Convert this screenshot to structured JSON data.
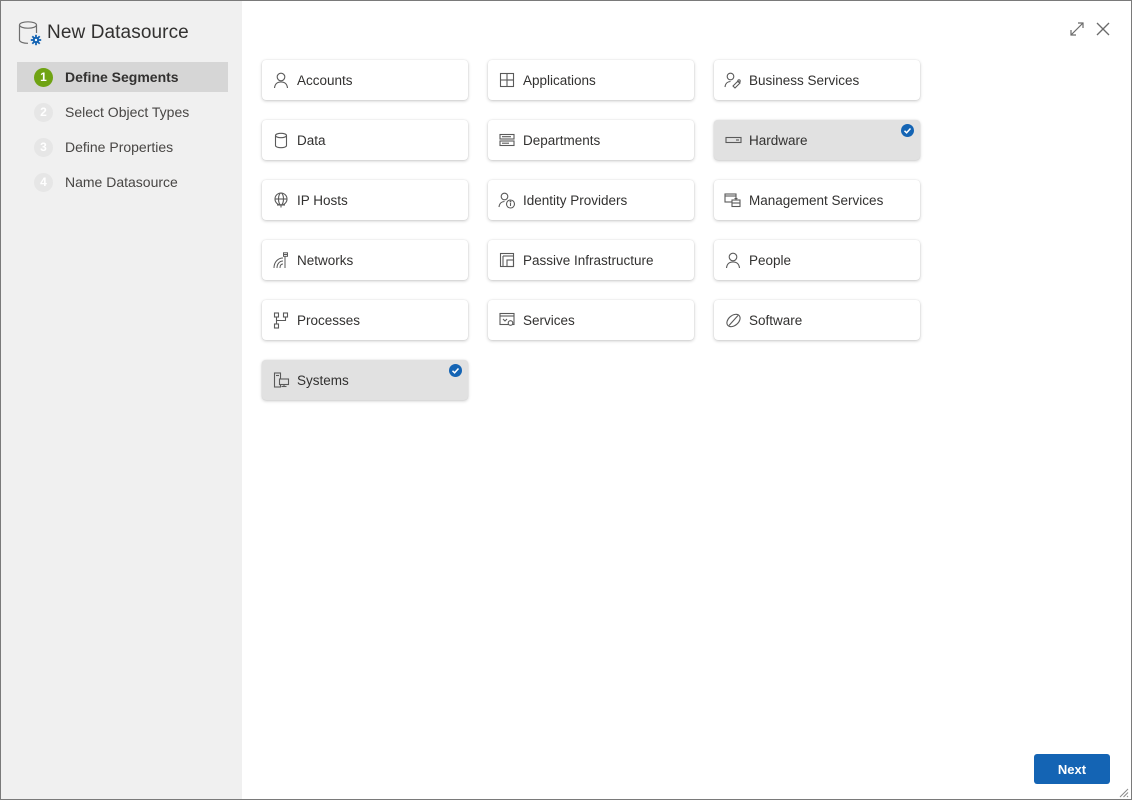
{
  "window": {
    "title": "New Datasource",
    "title_icon": "database-gear-icon"
  },
  "steps": [
    {
      "number": "1",
      "label": "Define Segments",
      "active": true
    },
    {
      "number": "2",
      "label": "Select Object Types",
      "active": false
    },
    {
      "number": "3",
      "label": "Define Properties",
      "active": false
    },
    {
      "number": "4",
      "label": "Name Datasource",
      "active": false
    }
  ],
  "segments": [
    {
      "label": "Accounts",
      "icon": "person-icon",
      "selected": false
    },
    {
      "label": "Applications",
      "icon": "applications-icon",
      "selected": false
    },
    {
      "label": "Business Services",
      "icon": "business-services-icon",
      "selected": false
    },
    {
      "label": "Data",
      "icon": "database-icon",
      "selected": false
    },
    {
      "label": "Departments",
      "icon": "departments-icon",
      "selected": false
    },
    {
      "label": "Hardware",
      "icon": "hardware-icon",
      "selected": true
    },
    {
      "label": "IP Hosts",
      "icon": "globe-monitor-icon",
      "selected": false
    },
    {
      "label": "Identity Providers",
      "icon": "identity-providers-icon",
      "selected": false
    },
    {
      "label": "Management Services",
      "icon": "management-services-icon",
      "selected": false
    },
    {
      "label": "Networks",
      "icon": "networks-icon",
      "selected": false
    },
    {
      "label": "Passive Infrastructure",
      "icon": "passive-infrastructure-icon",
      "selected": false
    },
    {
      "label": "People",
      "icon": "person-icon",
      "selected": false
    },
    {
      "label": "Processes",
      "icon": "processes-icon",
      "selected": false
    },
    {
      "label": "Services",
      "icon": "services-icon",
      "selected": false
    },
    {
      "label": "Software",
      "icon": "software-icon",
      "selected": false
    },
    {
      "label": "Systems",
      "icon": "systems-icon",
      "selected": true
    }
  ],
  "actions": {
    "expand": "expand-icon",
    "close": "close-icon",
    "next_label": "Next"
  },
  "colors": {
    "accent": "#1464b4",
    "step_active": "#6fa313",
    "sidebar_bg": "#f0f0f0",
    "selected_card_bg": "#e1e1e1"
  }
}
